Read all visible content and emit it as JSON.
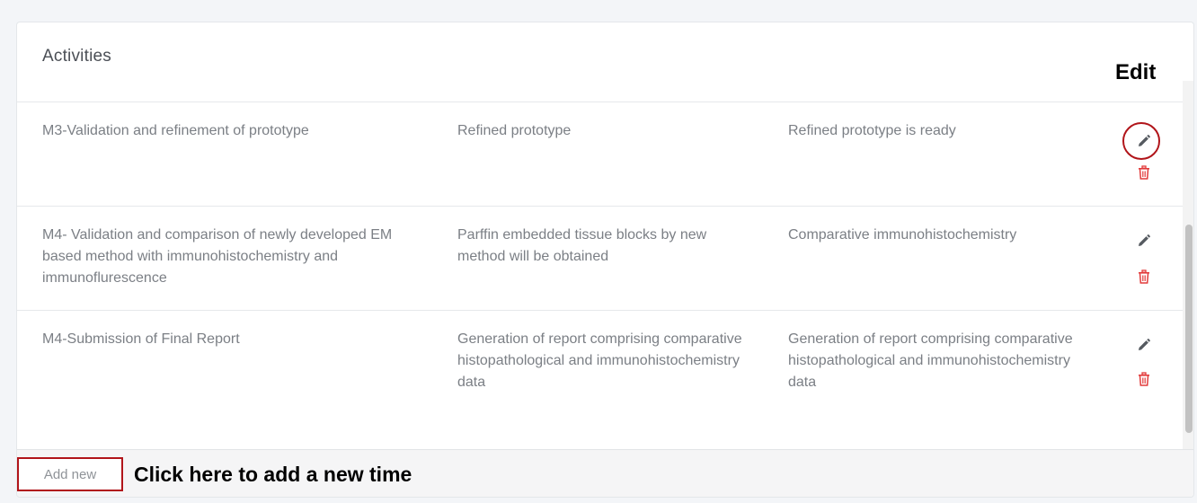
{
  "card": {
    "title": "Activities"
  },
  "annotations": {
    "edit_label": "Edit",
    "add_label": "Click here to add a new time"
  },
  "rows": [
    {
      "activity": "M3-Validation and refinement of prototype",
      "deliverable": "Refined prototype",
      "outcome": "Refined prototype is ready"
    },
    {
      "activity": "M4- Validation and comparison of newly developed EM based method with immunohistochemistry and immunoflurescence",
      "deliverable": "Parffin embedded tissue blocks by new method will be obtained",
      "outcome": "Comparative immunohistochemistry"
    },
    {
      "activity": "M4-Submission of Final Report",
      "deliverable": "Generation of report comprising comparative histopathological and immunohistochemistry data",
      "outcome": "Generation of report comprising comparative histopathological and immunohistochemistry data"
    }
  ],
  "icons": {
    "edit": "pencil-icon",
    "delete": "trash-icon"
  },
  "footer": {
    "add_button_label": "Add new"
  },
  "colors": {
    "delete_icon": "#e23b3b",
    "edit_icon": "#555a60",
    "highlight": "#b1151a"
  }
}
